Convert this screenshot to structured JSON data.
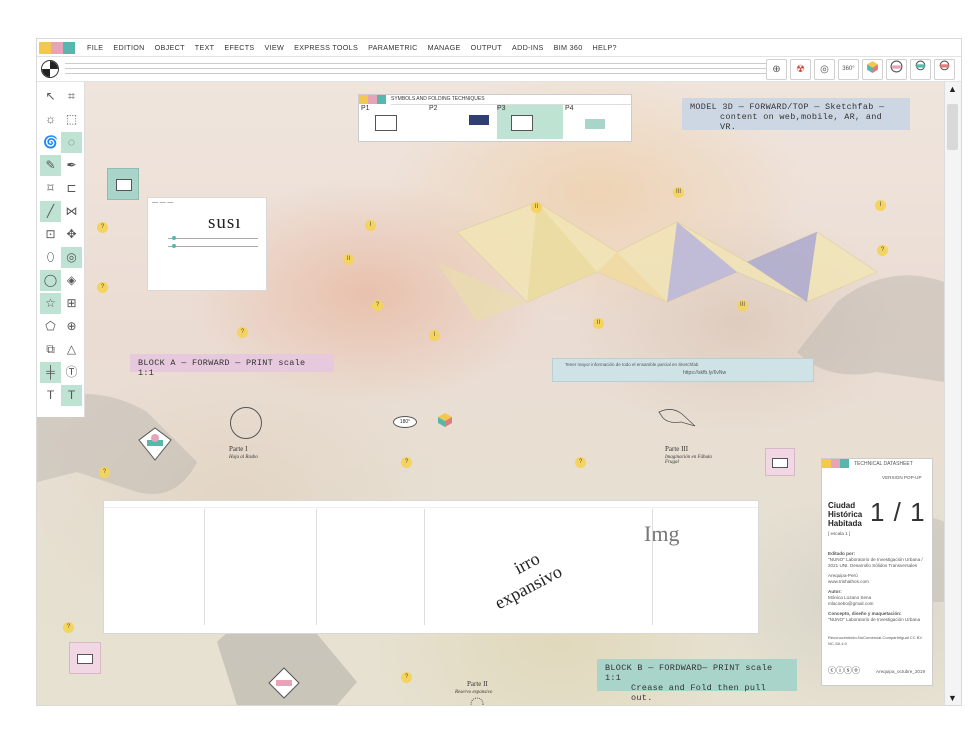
{
  "menu": {
    "swatches": [
      "#f2c94c",
      "#e7a3b8",
      "#56b8ad"
    ],
    "items": [
      "FILE",
      "EDITION",
      "OBJECT",
      "TEXT",
      "EFECTS",
      "VIEW",
      "EXPRESS TOOLS",
      "PARAMETRIC",
      "MANAGE",
      "OUTPUT",
      "ADD-INS",
      "BIM 360",
      "HELP?"
    ]
  },
  "toolbar": {
    "right_icons": [
      "crosshair-icon",
      "hazard-icon",
      "target-icon",
      "rotate-360-icon",
      "cube-icon",
      "vr-headset-icon",
      "vr-person-icon",
      "vr-user-icon"
    ],
    "rotate_label": "360°"
  },
  "tools": [
    "select-arrow-icon",
    "frame-icon",
    "sun-icon",
    "dotted-frame-icon",
    "spiral-icon",
    "lasso-icon",
    "pencil-icon",
    "pen-icon",
    "crop-icon",
    "crop2-icon",
    "brush-icon",
    "cut-icon",
    "resize-icon",
    "compass-icon",
    "drop-icon",
    "mask-icon",
    "circle-select-icon",
    "layers-icon",
    "star-icon",
    "grid-icon",
    "shapes-icon",
    "globe-icon",
    "box-icon",
    "triangle-icon",
    "align-icon",
    "text-circle-icon",
    "type-icon",
    "type2-icon",
    "underline-a-icon",
    "magic-wand-icon"
  ],
  "labels": {
    "model_3d": "MODEL 3D — FORWARD/TOP — Sketchfab —",
    "model_3d_sub": "content on web,mobile, AR, and VR.",
    "block_a": "BLOCK A — FORWARD — PRINT scale 1:1",
    "block_b": "BLOCK B — FORDWARD— PRINT scale 1:1",
    "block_b_sub": "Crease and Fold then pull out."
  },
  "symbols": {
    "title": "SYMBOLS AND FOLDING TECHNIQUES",
    "cells": [
      "P1",
      "P2",
      "P3",
      "P4"
    ]
  },
  "sheets": {
    "susi": "susı",
    "irro": "irro",
    "expansivo": "expansivo",
    "imag": "Img"
  },
  "parts": {
    "parte1": "Parte I",
    "parte1_sub": "Hoja al Rasho",
    "parte2": "Parte II",
    "parte2_sub": "Reservo expansivo",
    "parte3": "Parte III",
    "parte3_sub": "Imaginación en Fábula Frugal"
  },
  "sketchfab": {
    "title": "Tener mayor información de todo el ensamble parcial en Sketchfab",
    "url": "https://skfb.ly/6vNw"
  },
  "datasheet": {
    "header": "TECHNICAL DATASHEET",
    "version": "VERSION POP-UP",
    "title_lines": [
      "Ciudad",
      "Histórica",
      "Habitada"
    ],
    "subtitle": "[ escala 1 ]",
    "scale": "1 / 1",
    "edited_by": "Editado por:",
    "lab": "\"NUNO\" Laboratorio de Investigación Urbana / 2021 UNI. Desarrollo Sólidos Transversales",
    "place": "Arequipa-Perú",
    "web": "www.trishathos.com",
    "author_label": "Autor:",
    "author": "Mónica Lozano Sena",
    "email": "mlacoebo@gmail.com",
    "concept_label": "Concepto, diseño y maquetación:",
    "concept": "\"NUNO\" Laboratorio de Investigación Urbana",
    "license": "Reconocimiento-NoComercial-CompartirIgual CC BY-NC-SA 4.0",
    "date": "Arequipa_octubre_2019"
  },
  "colors": {
    "yellow": "#f2c94c",
    "pink": "#e7a3b8",
    "teal": "#56b8ad",
    "block_a_bg": "#e7c9dd",
    "model_bg": "#cdd7e4",
    "block_b_bg": "#a8d4c9"
  }
}
